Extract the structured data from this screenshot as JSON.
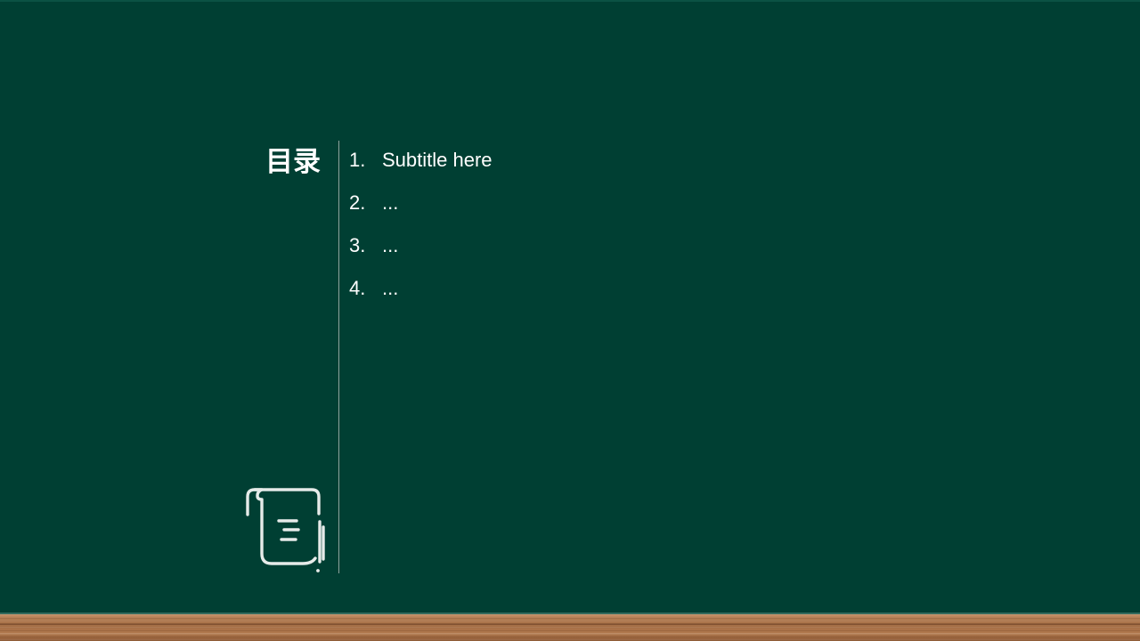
{
  "slide": {
    "title": "目录",
    "items": [
      {
        "number": "1.",
        "text": "Subtitle here"
      },
      {
        "number": "2.",
        "text": "..."
      },
      {
        "number": "3.",
        "text": "..."
      },
      {
        "number": "4.",
        "text": "..."
      }
    ],
    "icon": "scroll-document-icon"
  },
  "colors": {
    "background": "#003f33",
    "text": "#ffffff",
    "divider": "#8fa39d",
    "icon_stroke": "#e6ebe9",
    "floor": "#a56e46"
  }
}
